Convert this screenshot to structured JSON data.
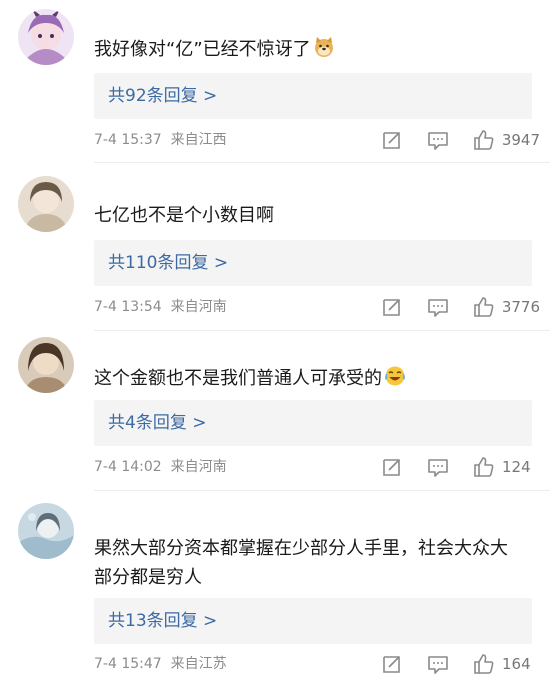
{
  "comments": [
    {
      "text": "我好像对“亿”已经不惊讶了",
      "emoji": "doge-emoji",
      "replies_label": "共92条回复 >",
      "time": "7-4 15:37",
      "location": "来自江西",
      "likes": "3947",
      "avatar_color": "#b58cc6"
    },
    {
      "text": "七亿也不是个小数目啊",
      "emoji": "",
      "replies_label": "共110条回复 >",
      "time": "7-4 13:54",
      "location": "来自河南",
      "likes": "3776",
      "avatar_color": "#c8b9a3"
    },
    {
      "text": "这个金额也不是我们普通人可承受的",
      "emoji": "laugh-cry-emoji",
      "replies_label": "共4条回复 >",
      "time": "7-4 14:02",
      "location": "来自河南",
      "likes": "124",
      "avatar_color": "#a88d73"
    },
    {
      "text": "果然大部分资本都掌握在少部分人手里，社会大众大部分都是穷人",
      "emoji": "",
      "replies_label": "共13条回复 >",
      "time": "7-4 15:47",
      "location": "来自江苏",
      "likes": "164",
      "avatar_color": "#8fb1c6"
    }
  ],
  "colors": {
    "link": "#3d6aa3",
    "meta": "#8c8c8c",
    "reply_bg": "#f4f4f4"
  }
}
